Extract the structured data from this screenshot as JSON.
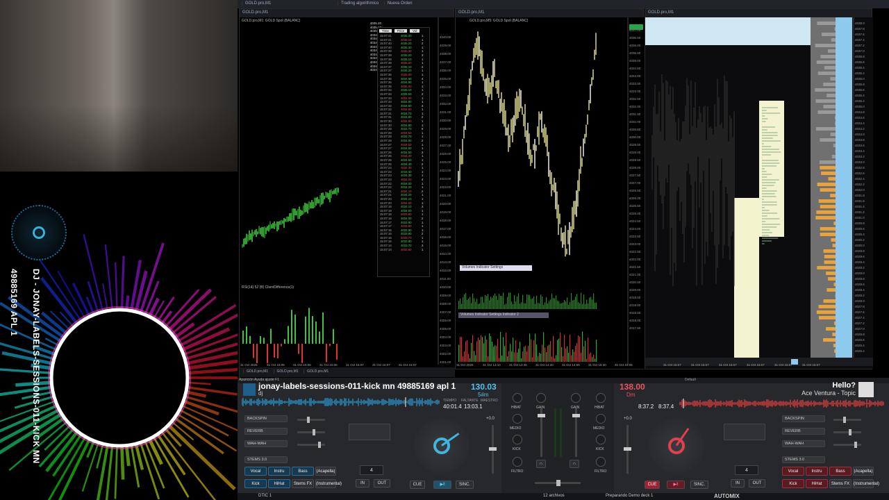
{
  "topbar": {
    "tabs": [
      "GOLD.pro,M1",
      "Trading algorithmico",
      "Nueva Orden"
    ],
    "window_titles": [
      "GOLD.pro,M1",
      "GOLD.pro,M1",
      "GOLD.pro,M1"
    ]
  },
  "left_chart": {
    "title": "GOLD.pro,M1: GOLD Spot (BALANC)",
    "sub_title": "RSI(14) 52 (B) ClientDifference(1)",
    "tabs": [
      "GOLD.pro,M1",
      "GOLD.pro,M1",
      "GOLD.pro,M1"
    ],
    "tape_headers": [
      "Time",
      "Price",
      "Vol"
    ],
    "depth_prices": [
      "4035.20",
      "4035.10",
      "4035.00",
      "4034.90",
      "4034.80",
      "4034.70",
      "4034.60",
      "4034.50",
      "4034.40",
      "4034.30",
      "4034.20",
      "4034.10",
      "4034.00"
    ],
    "tape_rows": [
      [
        "15:07:41",
        "4035.20",
        "1"
      ],
      [
        "15:07:41",
        "4035.10",
        "1"
      ],
      [
        "15:07:40",
        "4035.20",
        "2"
      ],
      [
        "15:07:40",
        "4035.30",
        "1"
      ],
      [
        "15:07:39",
        "4035.30",
        "1"
      ],
      [
        "15:07:39",
        "4035.20",
        "3"
      ],
      [
        "15:07:38",
        "4035.10",
        "1"
      ],
      [
        "15:07:38",
        "4035.00",
        "1"
      ],
      [
        "15:07:37",
        "4035.10",
        "2"
      ],
      [
        "15:07:37",
        "4035.20",
        "1"
      ],
      [
        "15:07:36",
        "4035.00",
        "1"
      ],
      [
        "15:07:36",
        "4034.90",
        "4"
      ],
      [
        "15:07:35",
        "4034.90",
        "1"
      ],
      [
        "15:07:35",
        "4035.00",
        "1"
      ],
      [
        "15:07:34",
        "4035.10",
        "1"
      ],
      [
        "15:07:34",
        "4035.00",
        "2"
      ],
      [
        "15:07:33",
        "4034.90",
        "1"
      ],
      [
        "15:07:33",
        "4034.80",
        "1"
      ],
      [
        "15:07:32",
        "4034.90",
        "3"
      ],
      [
        "15:07:32",
        "4034.80",
        "1"
      ],
      [
        "15:07:31",
        "4034.70",
        "1"
      ],
      [
        "15:07:31",
        "4034.80",
        "2"
      ],
      [
        "15:07:30",
        "4034.90",
        "1"
      ],
      [
        "15:07:30",
        "4034.80",
        "1"
      ],
      [
        "15:07:29",
        "4034.70",
        "5"
      ],
      [
        "15:07:29",
        "4034.60",
        "1"
      ],
      [
        "15:07:28",
        "4034.70",
        "1"
      ],
      [
        "15:07:28",
        "4034.60",
        "2"
      ],
      [
        "15:07:27",
        "4034.50",
        "1"
      ],
      [
        "15:07:27",
        "4034.60",
        "1"
      ],
      [
        "15:07:26",
        "4034.50",
        "3"
      ],
      [
        "15:07:26",
        "4034.40",
        "1"
      ],
      [
        "15:07:25",
        "4034.50",
        "1"
      ],
      [
        "15:07:25",
        "4034.40",
        "2"
      ],
      [
        "15:07:24",
        "4034.30",
        "1"
      ],
      [
        "15:07:24",
        "4034.40",
        "1"
      ],
      [
        "15:07:23",
        "4034.30",
        "1"
      ],
      [
        "15:07:23",
        "4034.20",
        "4"
      ],
      [
        "15:07:22",
        "4034.30",
        "1"
      ],
      [
        "15:07:22",
        "4034.20",
        "1"
      ],
      [
        "15:07:21",
        "4034.10",
        "2"
      ],
      [
        "15:07:21",
        "4034.20",
        "1"
      ],
      [
        "15:07:20",
        "4034.10",
        "1"
      ],
      [
        "15:07:20",
        "4034.00",
        "1"
      ],
      [
        "15:07:19",
        "4034.10",
        "3"
      ],
      [
        "15:07:19",
        "4034.00",
        "1"
      ],
      [
        "15:07:18",
        "4033.90",
        "1"
      ],
      [
        "15:07:18",
        "4034.00",
        "2"
      ],
      [
        "15:07:17",
        "4033.90",
        "1"
      ],
      [
        "15:07:17",
        "4033.80",
        "1"
      ],
      [
        "15:07:16",
        "4033.90",
        "1"
      ],
      [
        "15:07:16",
        "4033.80",
        "2"
      ],
      [
        "15:07:15",
        "4033.70",
        "1"
      ],
      [
        "15:07:15",
        "4033.80",
        "1"
      ],
      [
        "15:07:14",
        "4033.70",
        "3"
      ],
      [
        "15:07:14",
        "4033.60",
        "1"
      ]
    ],
    "time_labels": [
      "31 Oct 2025",
      "31 Oct 15:05",
      "31 Oct 15:06",
      "31 Oct 15:06",
      "31 Oct 15:07",
      "31 Oct 15:07",
      "31 Oct 15:07"
    ]
  },
  "mid_chart": {
    "title": "GOLD.pro,M5: GOLD Spot (BALANC)",
    "indicator": "Volumes Indicator Settings",
    "indicator2": "Volumes Indicator Settings Indicator 2",
    "time_labels": [
      "31 Oct 2025",
      "31 Oct 13:10",
      "31 Oct 13:45",
      "31 Oct 14:20",
      "31 Oct 14:55",
      "31 Oct 15:30",
      "31 Oct 16:05"
    ]
  },
  "right_chart": {
    "time_labels": [
      "31 Oct 15:07",
      "31 Oct 15:07",
      "31 Oct 15:07",
      "31 Oct 15:07",
      "31 Oct 15:07",
      "31 Oct 15:07"
    ]
  },
  "dj": {
    "menu": "Aparición  Ayuda  ajuste F1",
    "left_deck": {
      "track": "jonay-labels-sessions-011-kick mn 49885169 apl 1",
      "sub": "dj",
      "bpm": "130.03",
      "key": "5#m",
      "time_label_1": "TIEMPO",
      "time_label_2": "FALTANTE",
      "time_label_3": "MAESTRO",
      "elapsed": "40:01.4",
      "remaining": "13:03.1",
      "fx": [
        "BACKSPIN",
        "REVERB",
        "WAH-WAH"
      ],
      "stems": "STEMS 3.0",
      "pads1": [
        "Vocal",
        "Instru",
        "Bass",
        "(Acapella)"
      ],
      "pads2": [
        "Kick",
        "HiHat",
        "Stems FX",
        "(Instrumental)"
      ],
      "loop": "4",
      "pitch": "+0.0",
      "buttons": [
        "CUE",
        "SINC.",
        "IN",
        "OUT"
      ]
    },
    "right_deck": {
      "track": "Hello?",
      "artist": "Ace Ventura - Topic",
      "bpm": "138.00",
      "key": "Dm",
      "elapsed": "8:37.2",
      "remaining": "8:37.4",
      "fx": [
        "BACKSPIN",
        "REVERB",
        "WAH-WAH"
      ],
      "stems": "STEMS 3.0",
      "pads1": [
        "Vocal",
        "Instru",
        "Bass",
        "(Acapella)"
      ],
      "pads2": [
        "Kick",
        "HiHat",
        "Stems FX",
        "(Instrumental)"
      ],
      "loop": "4",
      "pitch": "+0.0",
      "buttons": [
        "CUE",
        "SINC.",
        "IN",
        "OUT"
      ]
    },
    "mixer": {
      "labels": [
        "HIBAT",
        "GAIN",
        "GAIN",
        "HIBAT",
        "MEDIO",
        "MEDIO",
        "KICK",
        "KICK",
        "FILTRO",
        "FILTRO"
      ]
    },
    "browser": {
      "item": "DTIC 1",
      "count": "12 archivos",
      "status": "Preparando Demo deck 1",
      "automix": "AUTOMIX",
      "default": "Default"
    }
  },
  "visualizer": {
    "vertical_text": "DJ - JONAY-LABELS-SESSIONS-011-KICK MN 49885169 APL 1"
  }
}
